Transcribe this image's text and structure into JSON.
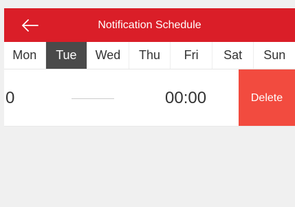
{
  "header": {
    "title": "Notification Schedule",
    "back_icon": "arrow-left-icon"
  },
  "days": [
    {
      "label": "Mon",
      "selected": false
    },
    {
      "label": "Tue",
      "selected": true
    },
    {
      "label": "Wed",
      "selected": false
    },
    {
      "label": "Thu",
      "selected": false
    },
    {
      "label": "Fri",
      "selected": false
    },
    {
      "label": "Sat",
      "selected": false
    },
    {
      "label": "Sun",
      "selected": false
    }
  ],
  "schedule": {
    "start_time": "0",
    "end_time": "00:00",
    "delete_label": "Delete"
  },
  "colors": {
    "header_background": "#da1e28",
    "selected_day_background": "#4a4a4a",
    "delete_background": "#f24b3f",
    "page_background": "#f0f0f0"
  }
}
